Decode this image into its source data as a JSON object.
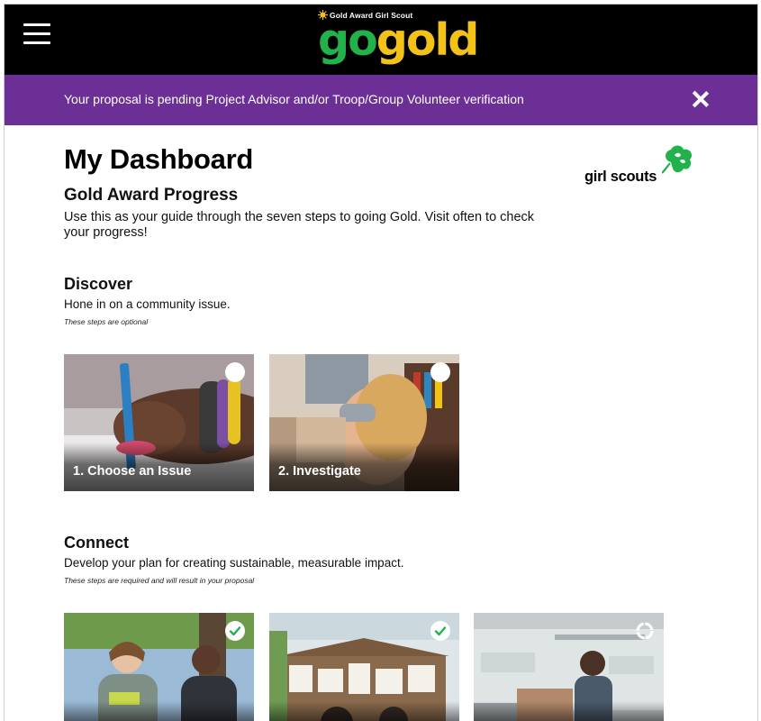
{
  "header": {
    "logo_tagline": "Gold Award Girl Scout",
    "logo_word_1": "go",
    "logo_word_2": "gold"
  },
  "banner": {
    "message": "Your proposal is pending Project Advisor and/or Troop/Group Volunteer verification"
  },
  "brand": {
    "name": "girl scouts"
  },
  "dashboard": {
    "title": "My Dashboard",
    "section_heading": "Gold Award Progress",
    "intro": "Use this as your guide through the seven steps to going Gold. Visit often to check your progress!"
  },
  "groups": [
    {
      "title": "Discover",
      "description": "Hone in on a community issue.",
      "note": "These steps are optional",
      "steps": [
        {
          "label": "1. Choose an Issue",
          "status": "incomplete",
          "icon": "empty-circle-icon"
        },
        {
          "label": "2. Investigate",
          "status": "incomplete",
          "icon": "empty-circle-icon"
        }
      ]
    },
    {
      "title": "Connect",
      "description": "Develop your plan for creating sustainable, measurable impact.",
      "note": "These steps are required and will result in your proposal",
      "steps": [
        {
          "label": "",
          "status": "complete",
          "icon": "check-circle-icon"
        },
        {
          "label": "",
          "status": "complete",
          "icon": "check-circle-icon"
        },
        {
          "label": "",
          "status": "in-progress",
          "icon": "progress-ring-icon"
        }
      ]
    }
  ],
  "colors": {
    "topbar": "#000000",
    "banner": "#6b2f96",
    "go_green": "#22b24c",
    "gold_yellow": "#f3c218",
    "check_green": "#22b24c"
  }
}
